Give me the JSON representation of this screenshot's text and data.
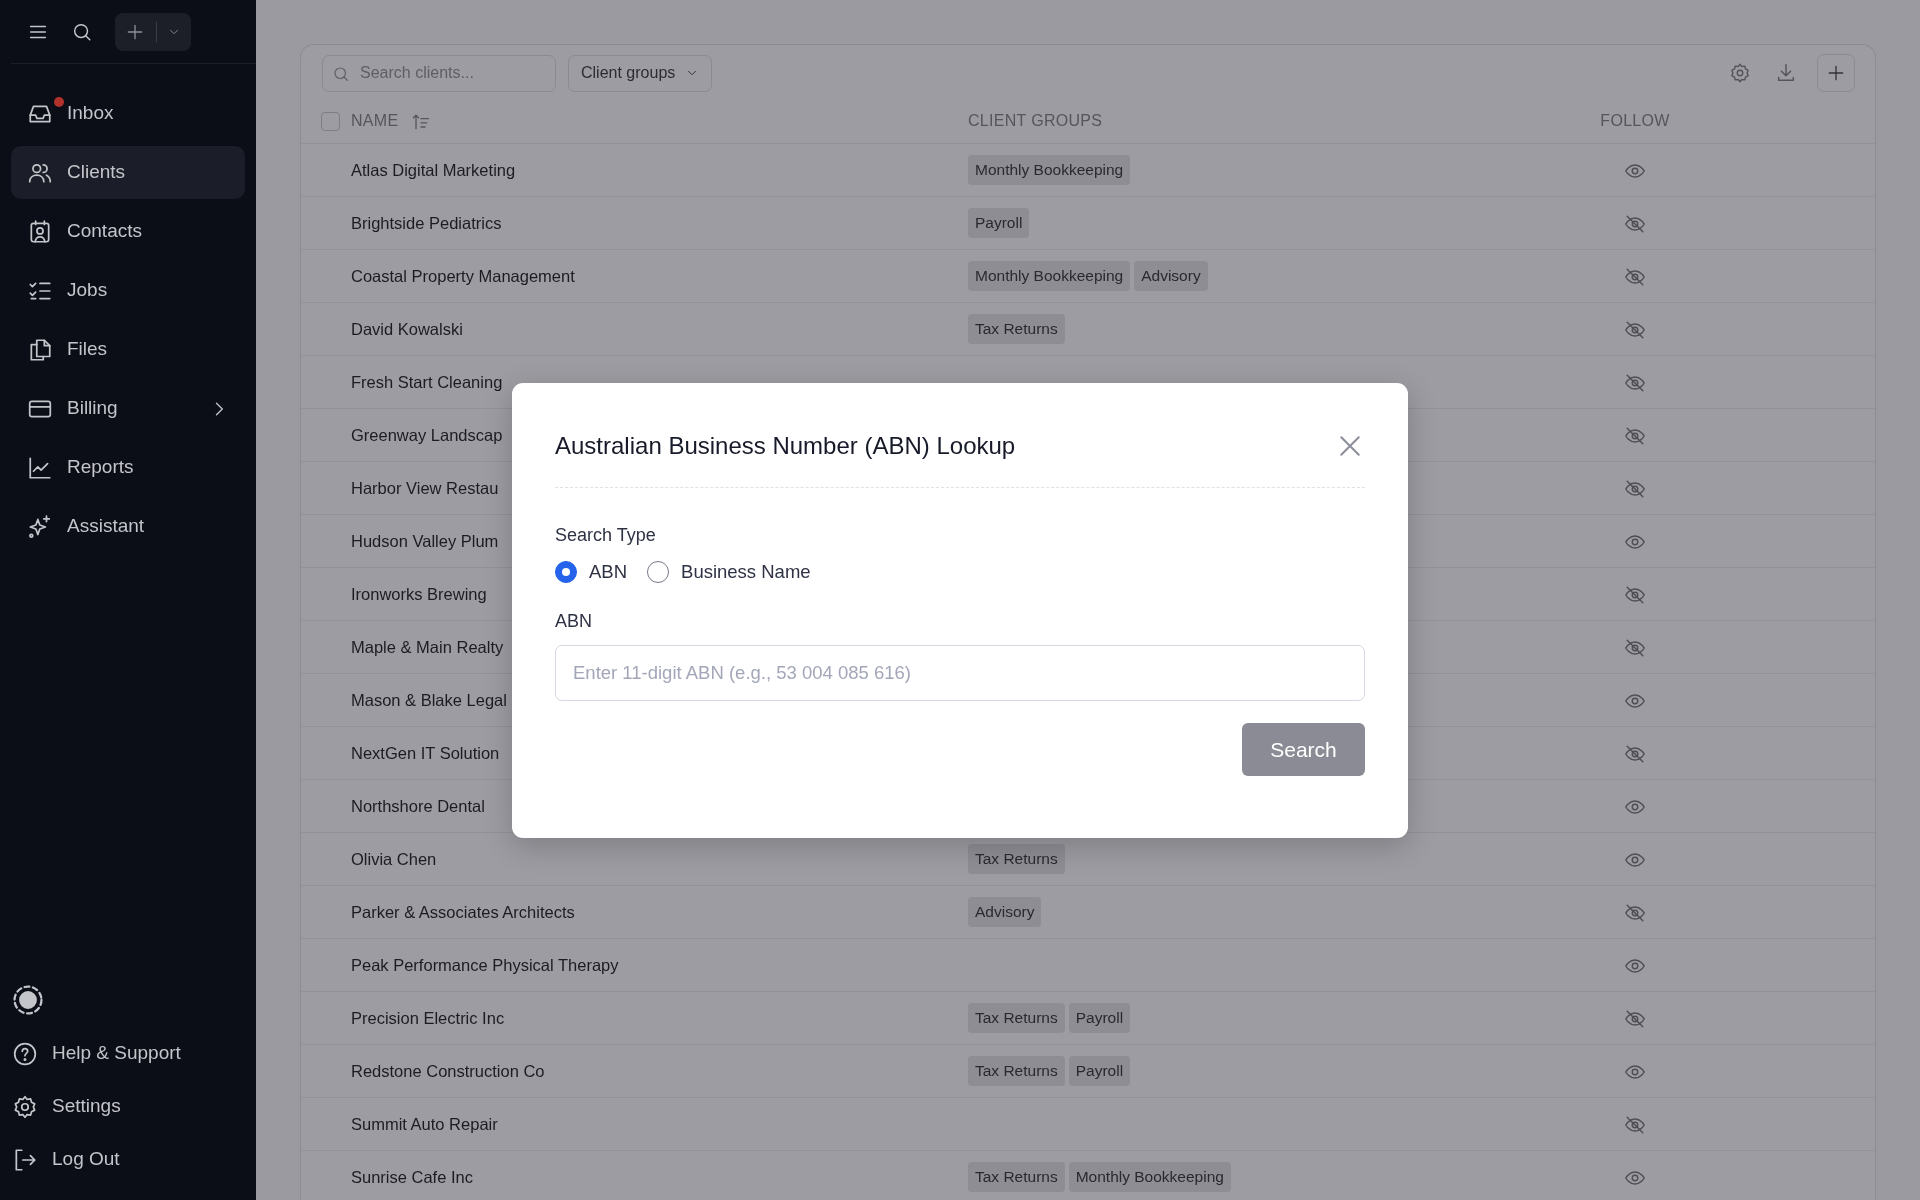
{
  "sidebar": {
    "nav": [
      {
        "label": "Inbox",
        "selected": false,
        "unread": true,
        "has_submenu": false
      },
      {
        "label": "Clients",
        "selected": true,
        "unread": false,
        "has_submenu": false
      },
      {
        "label": "Contacts",
        "selected": false,
        "unread": false,
        "has_submenu": false
      },
      {
        "label": "Jobs",
        "selected": false,
        "unread": false,
        "has_submenu": false
      },
      {
        "label": "Files",
        "selected": false,
        "unread": false,
        "has_submenu": false
      },
      {
        "label": "Billing",
        "selected": false,
        "unread": false,
        "has_submenu": true
      },
      {
        "label": "Reports",
        "selected": false,
        "unread": false,
        "has_submenu": false
      },
      {
        "label": "Assistant",
        "selected": false,
        "unread": false,
        "has_submenu": false
      }
    ],
    "footer": [
      {
        "label": "Help & Support"
      },
      {
        "label": "Settings"
      },
      {
        "label": "Log Out"
      }
    ]
  },
  "toolbar": {
    "search": {
      "placeholder": "Search clients..."
    },
    "filter": "Client groups"
  },
  "table": {
    "select_all": {
      "checked": false
    },
    "columns": [
      "NAME",
      "CLIENT GROUPS",
      "FOLLOW"
    ],
    "rows": [
      {
        "name": "Atlas Digital Marketing",
        "groups": [
          "Monthly Bookkeeping"
        ],
        "following": true
      },
      {
        "name": "Brightside Pediatrics",
        "groups": [
          "Payroll"
        ],
        "following": false
      },
      {
        "name": "Coastal Property Management",
        "groups": [
          "Monthly Bookkeeping",
          "Advisory"
        ],
        "following": false
      },
      {
        "name": "David Kowalski",
        "groups": [
          "Tax Returns"
        ],
        "following": false
      },
      {
        "name": "Fresh Start Cleaning",
        "groups": [],
        "following": false
      },
      {
        "name": "Greenway Landscap",
        "groups": [],
        "following": false
      },
      {
        "name": "Harbor View Restau",
        "groups": [],
        "following": false
      },
      {
        "name": "Hudson Valley Plum",
        "groups": [],
        "following": true
      },
      {
        "name": "Ironworks Brewing",
        "groups": [],
        "following": false
      },
      {
        "name": "Maple & Main Realty",
        "groups": [],
        "following": false
      },
      {
        "name": "Mason & Blake Legal",
        "groups": [],
        "following": true
      },
      {
        "name": "NextGen IT Solution",
        "groups": [],
        "following": false
      },
      {
        "name": "Northshore Dental",
        "groups": [],
        "following": true
      },
      {
        "name": "Olivia Chen",
        "groups": [
          "Tax Returns"
        ],
        "following": true
      },
      {
        "name": "Parker & Associates Architects",
        "groups": [
          "Advisory"
        ],
        "following": false
      },
      {
        "name": "Peak Performance Physical Therapy",
        "groups": [],
        "following": true
      },
      {
        "name": "Precision Electric Inc",
        "groups": [
          "Tax Returns",
          "Payroll"
        ],
        "following": false
      },
      {
        "name": "Redstone Construction Co",
        "groups": [
          "Tax Returns",
          "Payroll"
        ],
        "following": true
      },
      {
        "name": "Summit Auto Repair",
        "groups": [],
        "following": false
      },
      {
        "name": "Sunrise Cafe Inc",
        "groups": [
          "Tax Returns",
          "Monthly Bookkeeping"
        ],
        "following": true
      }
    ]
  },
  "modal": {
    "title": "Australian Business Number (ABN) Lookup",
    "search_type_label": "Search Type",
    "options": [
      {
        "label": "ABN",
        "selected": true
      },
      {
        "label": "Business Name",
        "selected": false
      }
    ],
    "field_label": "ABN",
    "field": {
      "placeholder": "Enter 11-digit ABN (e.g., 53 004 085 616)"
    },
    "button": "Search"
  }
}
